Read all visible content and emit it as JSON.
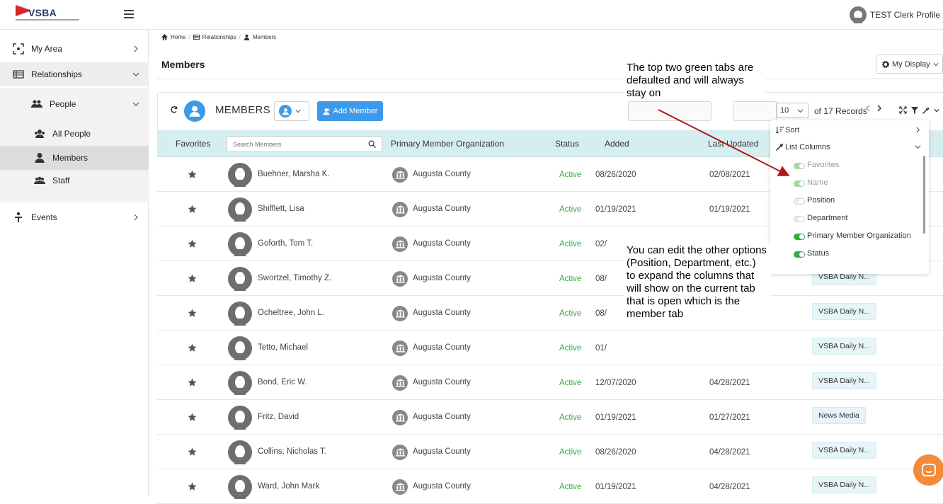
{
  "app": {
    "logo_text": "VSBA",
    "profile_name": "TEST Clerk Profile"
  },
  "sidebar": {
    "items": [
      {
        "label": "My Area",
        "icon": "focus-icon"
      },
      {
        "label": "Relationships",
        "icon": "list-icon"
      },
      {
        "label": "People",
        "icon": "people-icon"
      },
      {
        "label": "All People",
        "icon": "group-icon"
      },
      {
        "label": "Members",
        "icon": "person-icon",
        "active": true
      },
      {
        "label": "Staff",
        "icon": "staff-icon"
      },
      {
        "label": "Events",
        "icon": "events-icon"
      }
    ]
  },
  "breadcrumb": {
    "home": "Home",
    "relationships": "Relationships",
    "members": "Members"
  },
  "page": {
    "title": "Members",
    "my_display": "My Display"
  },
  "list": {
    "title": "MEMBERS",
    "add_button": "Add Member",
    "page_size": "10",
    "records_text": "of 17 Records",
    "search_placeholder": "Search Members",
    "columns": {
      "favorites": "Favorites",
      "org": "Primary Member Organization",
      "status": "Status",
      "added": "Added",
      "updated": "Last Updated"
    },
    "rows": [
      {
        "name": "Buehner, Marsha K.",
        "org": "Augusta County",
        "status": "Active",
        "added": "08/26/2020",
        "updated": "02/08/2021",
        "tag": ""
      },
      {
        "name": "Shifflett, Lisa",
        "org": "Augusta County",
        "status": "Active",
        "added": "01/19/2021",
        "updated": "01/19/2021",
        "tag": ""
      },
      {
        "name": "Goforth, Tom T.",
        "org": "Augusta County",
        "status": "Active",
        "added": "02/",
        "updated": "",
        "tag": ""
      },
      {
        "name": "Swortzel, Timothy Z.",
        "org": "Augusta County",
        "status": "Active",
        "added": "08/",
        "updated": "",
        "tag": "VSBA Daily N..."
      },
      {
        "name": "Ocheltree, John L.",
        "org": "Augusta County",
        "status": "Active",
        "added": "08/",
        "updated": "",
        "tag": "VSBA Daily N..."
      },
      {
        "name": "Tetto, Michael",
        "org": "Augusta County",
        "status": "Active",
        "added": "01/",
        "updated": "",
        "tag": "VSBA Daily N..."
      },
      {
        "name": "Bond, Eric W.",
        "org": "Augusta County",
        "status": "Active",
        "added": "12/07/2020",
        "updated": "04/28/2021",
        "tag": "VSBA Daily N..."
      },
      {
        "name": "Fritz, David",
        "org": "Augusta County",
        "status": "Active",
        "added": "01/19/2021",
        "updated": "01/27/2021",
        "tag": "News Media"
      },
      {
        "name": "Collins, Nicholas T.",
        "org": "Augusta County",
        "status": "Active",
        "added": "08/26/2020",
        "updated": "04/28/2021",
        "tag": "VSBA Daily N..."
      },
      {
        "name": "Ward, John Mark",
        "org": "Augusta County",
        "status": "Active",
        "added": "01/19/2021",
        "updated": "04/28/2021",
        "tag": "VSBA Daily N..."
      }
    ]
  },
  "dropdown": {
    "sort": "Sort",
    "list_columns": "List Columns",
    "columns": [
      {
        "label": "Favorites",
        "on": true,
        "locked": true
      },
      {
        "label": "Name",
        "on": true,
        "locked": true
      },
      {
        "label": "Position",
        "on": false
      },
      {
        "label": "Department",
        "on": false
      },
      {
        "label": "Primary Member Organization",
        "on": true
      },
      {
        "label": "Status",
        "on": true
      }
    ]
  },
  "annotations": {
    "note1": "The top two green tabs are defaulted and will always stay on",
    "note2": "You can edit the other options (Position, Department, etc.) to expand the columns that will show on the current tab that is open which is the member tab"
  },
  "colors": {
    "accent": "#3d9ae8",
    "active_status": "#3aa845",
    "header_bg": "#d7eef1",
    "arrow": "#b01818",
    "chat": "#f58a3a"
  }
}
